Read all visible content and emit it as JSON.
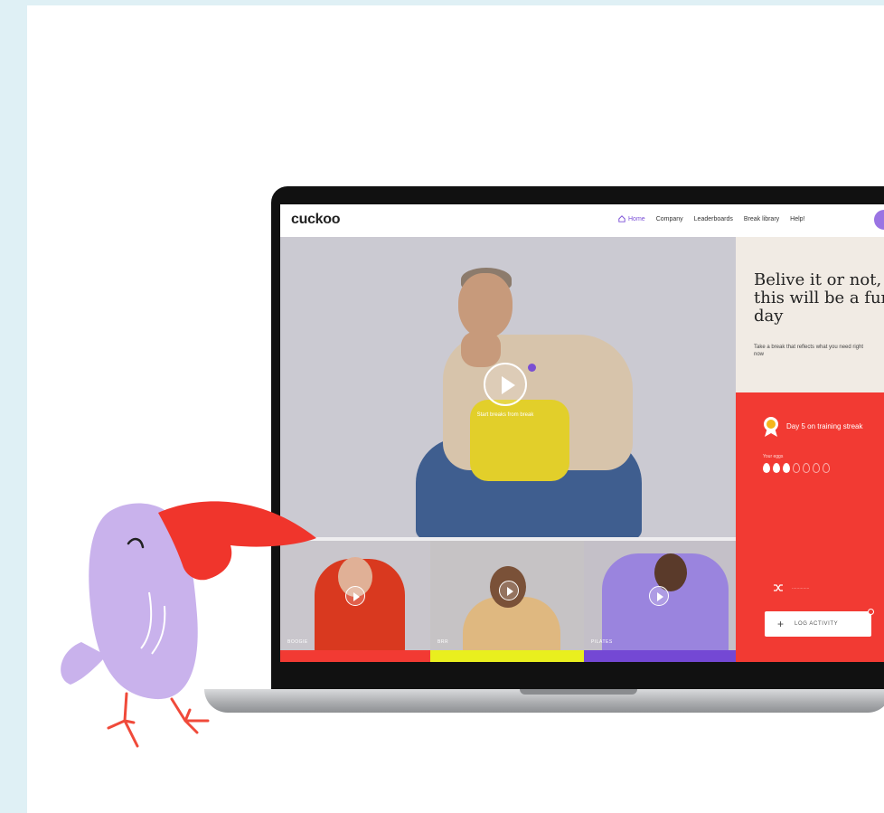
{
  "site": {
    "logo": "cuckoo"
  },
  "nav": {
    "links": [
      {
        "label": "Home",
        "active": true,
        "icon": "home-icon"
      },
      {
        "label": "Company"
      },
      {
        "label": "Leaderboards"
      },
      {
        "label": "Break library"
      },
      {
        "label": "Help!"
      }
    ]
  },
  "hero": {
    "caption": "Start breaks from break"
  },
  "panel": {
    "title": "Belive it or not, this will be a fun day",
    "subtitle": "Take a break that reflects what you need right now",
    "streak": "Day 5 on training streak",
    "eggs_label": "Your eggs",
    "eggs_filled": 3,
    "eggs_total": 7,
    "shuffle_text": "..............",
    "log_button": "LOG ACTIVITY"
  },
  "thumbnails": [
    {
      "label": "BOOGIE",
      "bar_color": "#f23a33"
    },
    {
      "label": "BRR",
      "bar_color": "#e9ef1e"
    },
    {
      "label": "PILATES",
      "bar_color": "#7448d4"
    }
  ],
  "colors": {
    "accent_purple": "#7b4fd6",
    "accent_red": "#f23a33",
    "accent_yellow": "#e9ef1e",
    "frame": "#dff0f5",
    "bird_body": "#c9b2ec",
    "bird_beak": "#f0352c"
  }
}
